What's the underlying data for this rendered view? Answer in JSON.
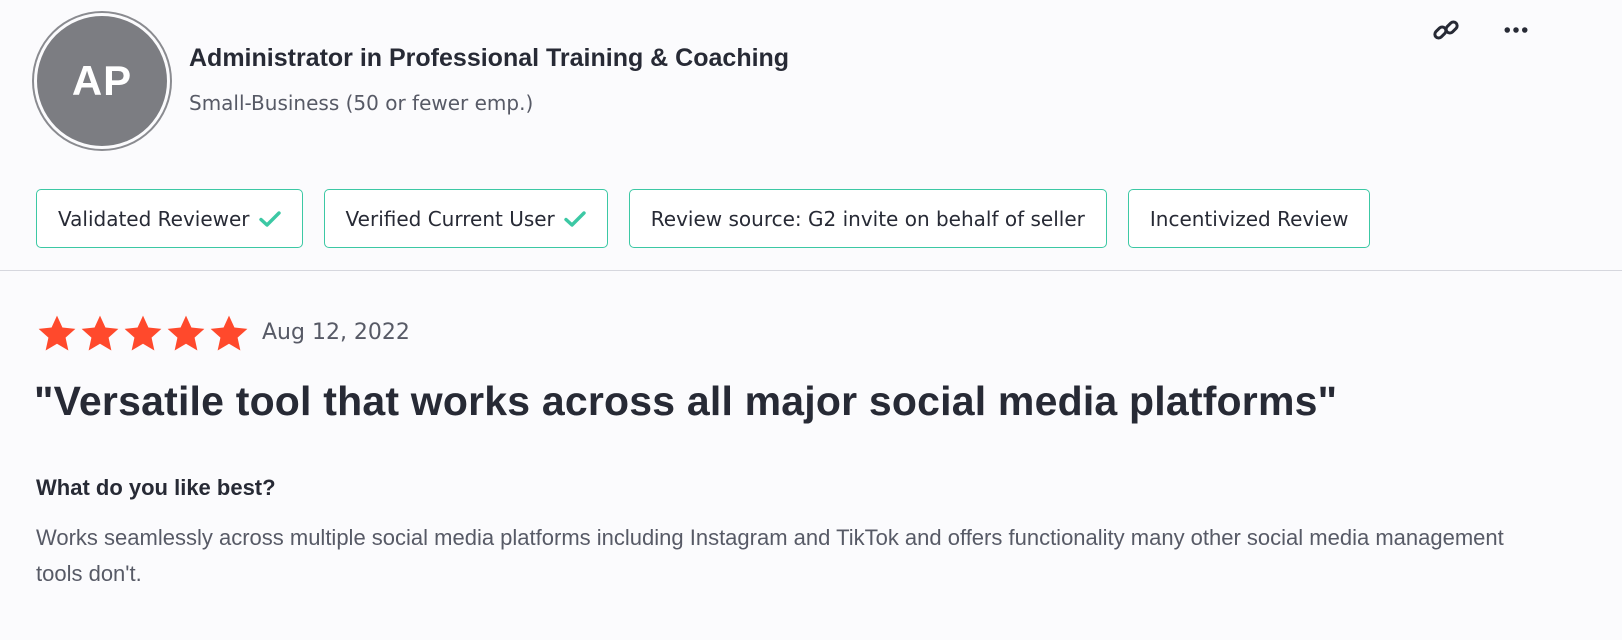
{
  "reviewer": {
    "initials": "AP",
    "title": "Administrator in Professional Training & Coaching",
    "company_size": "Small-Business (50 or fewer emp.)"
  },
  "actions": {
    "link_icon": "link-icon",
    "more_icon": "more-horizontal-icon"
  },
  "badges": [
    {
      "label": "Validated Reviewer",
      "checked": true
    },
    {
      "label": "Verified Current User",
      "checked": true
    },
    {
      "label": "Review source: G2 invite on behalf of seller",
      "checked": false
    },
    {
      "label": "Incentivized Review",
      "checked": false
    }
  ],
  "review": {
    "rating": 5,
    "rating_max": 5,
    "date": "Aug 12, 2022",
    "title": "\"Versatile tool that works across all major social media platforms\"",
    "question": "What do you like best?",
    "answer": "Works seamlessly across multiple social media platforms including Instagram and TikTok and offers functionality many other social media management tools don't."
  },
  "colors": {
    "accent_green": "#3cc8a4",
    "star_red": "#ff492c",
    "avatar_gray": "#7c7d82"
  }
}
